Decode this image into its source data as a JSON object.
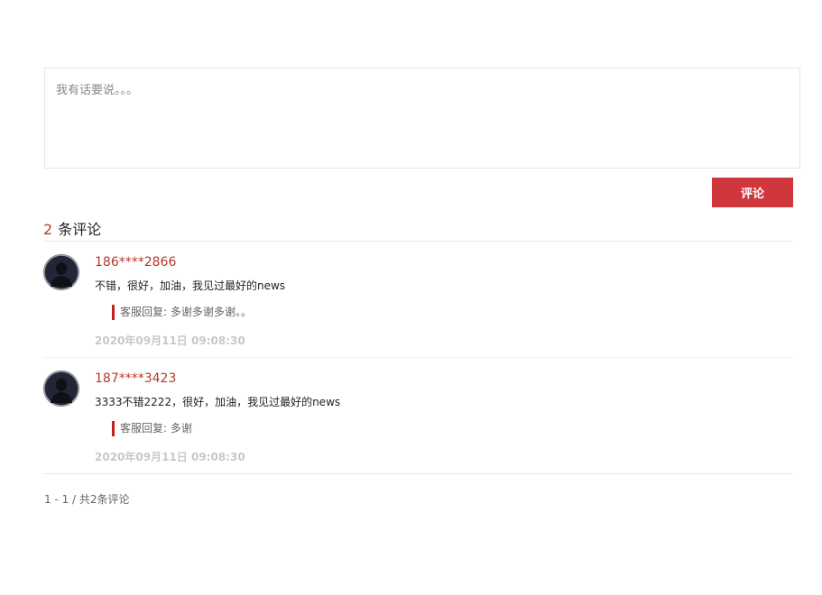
{
  "comment_input": {
    "placeholder": "我有话要说。。。"
  },
  "submit_label": "评论",
  "count": {
    "number": "2",
    "label": "条评论"
  },
  "comments": [
    {
      "username": "186****2866",
      "text": "不错，很好，加油，我见过最好的news",
      "reply": "客服回复: 多谢多谢多谢。。",
      "time": "2020年09月11日 09:08:30"
    },
    {
      "username": "187****3423",
      "text": "3333不错2222，很好，加油，我见过最好的news",
      "reply": "客服回复: 多谢",
      "time": "2020年09月11日 09:08:30"
    }
  ],
  "pagination": "1 - 1 / 共2条评论",
  "colors": {
    "accent": "#d0373c",
    "username": "#b23a2d",
    "reply_bar": "#c0241f"
  }
}
